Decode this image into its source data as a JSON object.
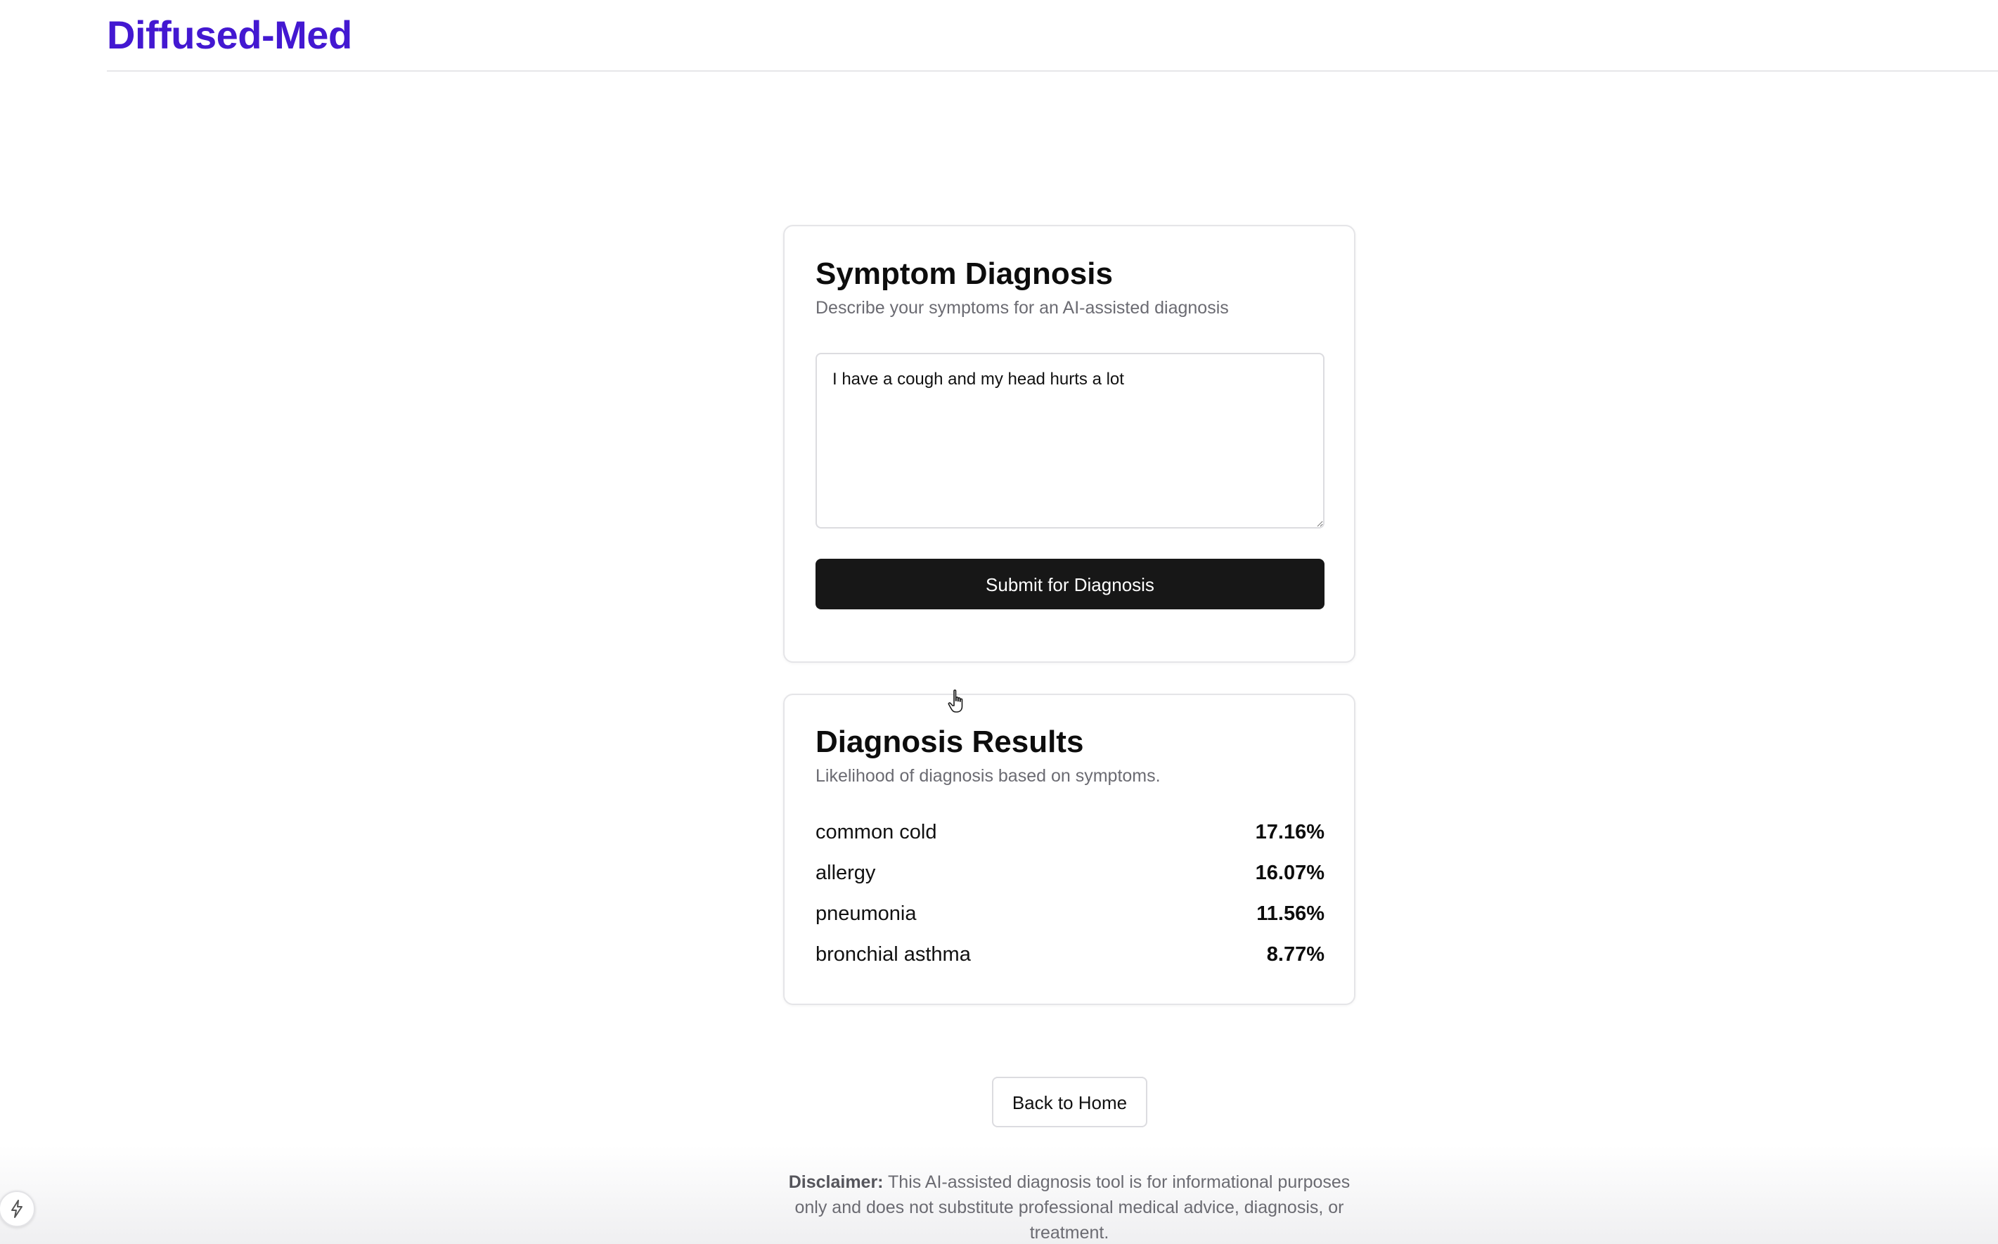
{
  "brand": {
    "name": "Diffused-Med",
    "color": "#4318d1"
  },
  "symptom_card": {
    "title": "Symptom Diagnosis",
    "subtitle": "Describe your symptoms for an AI-assisted diagnosis",
    "textarea_value": "I have a cough and my head hurts a lot",
    "submit_label": "Submit for Diagnosis"
  },
  "results_card": {
    "title": "Diagnosis Results",
    "subtitle": "Likelihood of diagnosis based on symptoms.",
    "items": [
      {
        "name": "common cold",
        "value": "17.16%"
      },
      {
        "name": "allergy",
        "value": "16.07%"
      },
      {
        "name": "pneumonia",
        "value": "11.56%"
      },
      {
        "name": "bronchial asthma",
        "value": "8.77%"
      }
    ]
  },
  "back_button_label": "Back to Home",
  "disclaimer": {
    "label": "Disclaimer:",
    "text": "This AI-assisted diagnosis tool is for informational purposes only and does not substitute professional medical advice, diagnosis, or treatment."
  },
  "icons": {
    "cursor": "hand-pointer-icon",
    "corner_badge": "lightning-bolt-icon"
  }
}
